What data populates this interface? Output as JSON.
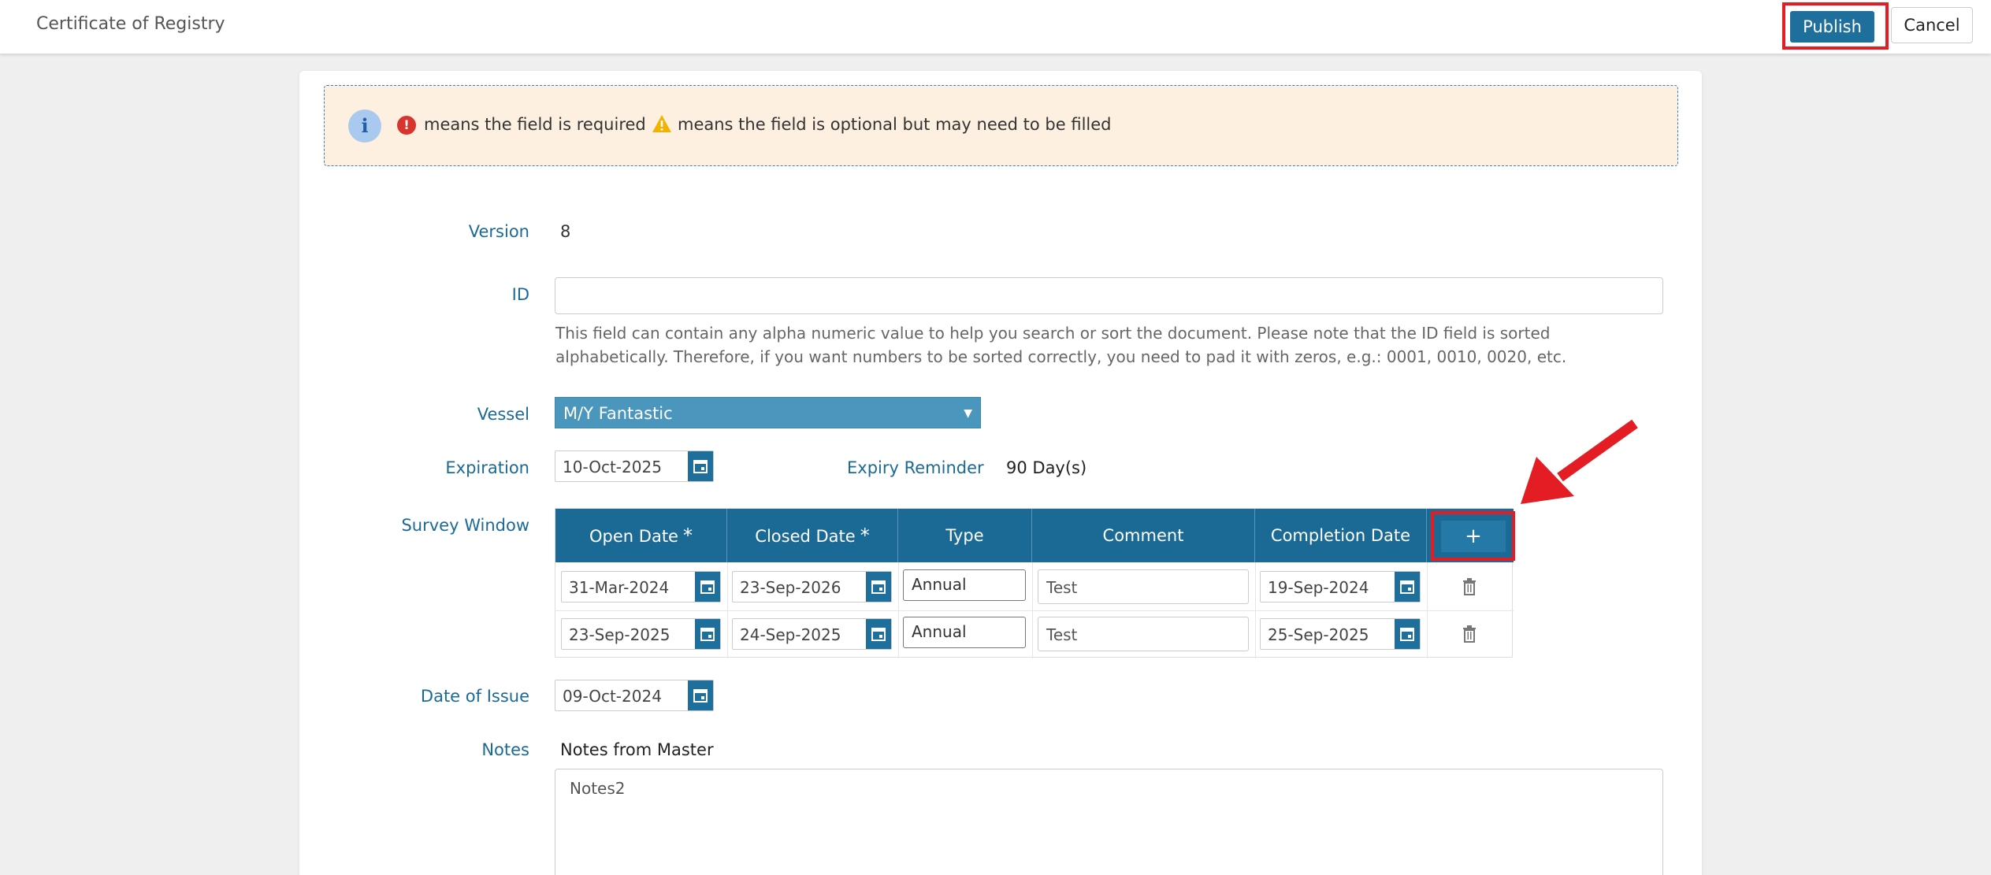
{
  "header": {
    "title": "Certificate of Registry",
    "publish_label": "Publish",
    "cancel_label": "Cancel"
  },
  "info": {
    "required_text": "means the field is required",
    "optional_text": "means the field is optional but may need to be filled"
  },
  "form": {
    "version_label": "Version",
    "version_value": "8",
    "id_label": "ID",
    "id_value": "",
    "id_help": "This field can contain any alpha numeric value to help you search or sort the document. Please note that the ID field is sorted alphabetically. Therefore, if you want numbers to be sorted correctly, you need to pad it with zeros, e.g.: 0001, 0010, 0020, etc.",
    "vessel_label": "Vessel",
    "vessel_value": "M/Y Fantastic",
    "expiration_label": "Expiration",
    "expiration_value": "10-Oct-2025",
    "expiry_reminder_label": "Expiry Reminder",
    "expiry_reminder_value": "90 Day(s)",
    "survey_label": "Survey Window",
    "date_of_issue_label": "Date of Issue",
    "date_of_issue_value": "09-Oct-2024",
    "notes_label": "Notes",
    "notes_from_master_label": "Notes from Master",
    "notes_value": "Notes2"
  },
  "survey": {
    "columns": {
      "open_date": "Open Date",
      "closed_date": "Closed Date",
      "type": "Type",
      "comment": "Comment",
      "completion_date": "Completion Date"
    },
    "required_mark": "*",
    "add_label": "+",
    "rows": [
      {
        "open": "31-Mar-2024",
        "closed": "23-Sep-2026",
        "type": "Annual",
        "comment": "Test",
        "completion": "19-Sep-2024"
      },
      {
        "open": "23-Sep-2025",
        "closed": "24-Sep-2025",
        "type": "Annual",
        "comment": "Test",
        "completion": "25-Sep-2025"
      }
    ]
  },
  "colors": {
    "primary": "#1f6f9c",
    "label": "#1b6a96",
    "highlight": "#e41c23",
    "info_bg": "#fdf0e0"
  }
}
